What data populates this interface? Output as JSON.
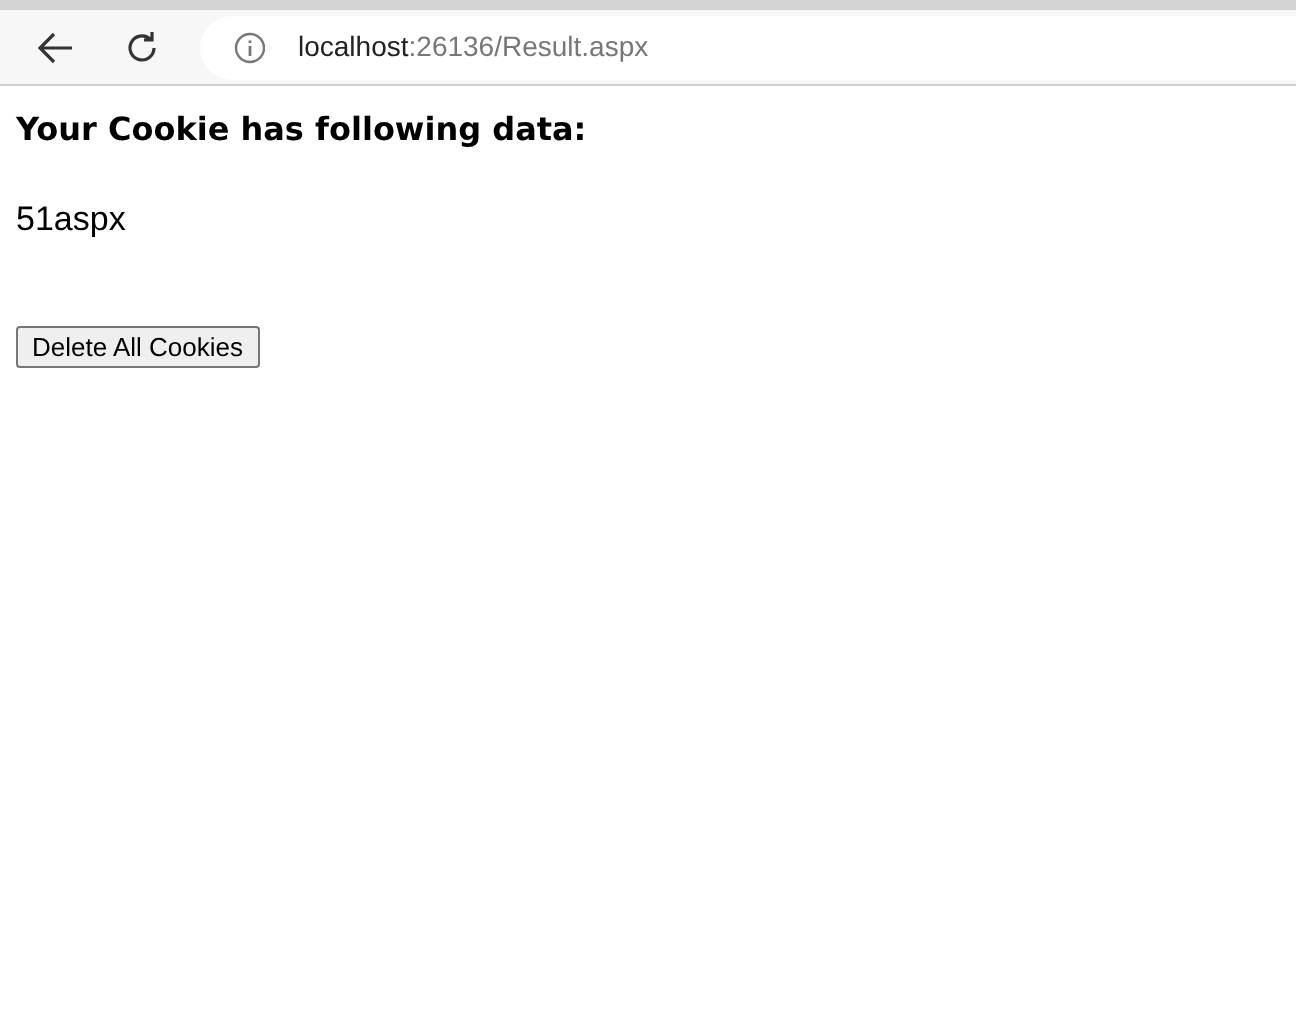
{
  "browser": {
    "url_host": "localhost",
    "url_path": ":26136/Result.aspx"
  },
  "page": {
    "heading": "Your Cookie has following data:",
    "cookie_value": "51aspx",
    "button": "Delete All Cookies"
  }
}
